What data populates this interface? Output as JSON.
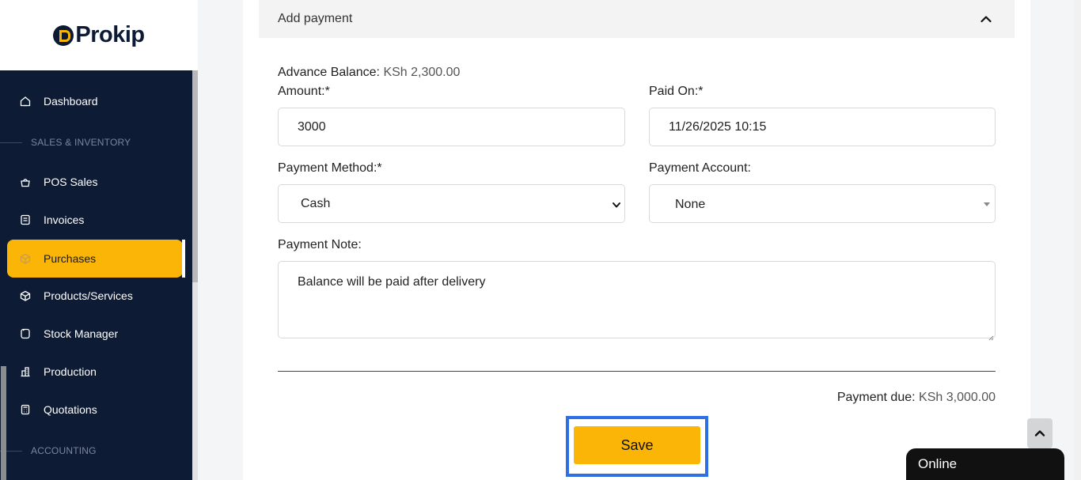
{
  "brand": {
    "logo_text": "Prokip"
  },
  "sidebar": {
    "items": [
      {
        "label": "Dashboard",
        "icon": "home-icon"
      },
      {
        "label": "POS Sales",
        "icon": "basket-icon"
      },
      {
        "label": "Invoices",
        "icon": "invoice-icon"
      },
      {
        "label": "Purchases",
        "icon": "box-icon",
        "active": true
      },
      {
        "label": "Products/Services",
        "icon": "cube-icon"
      },
      {
        "label": "Stock Manager",
        "icon": "stock-icon"
      },
      {
        "label": "Production",
        "icon": "factory-icon"
      },
      {
        "label": "Quotations",
        "icon": "calculator-icon"
      }
    ],
    "sections": [
      "SALES & INVENTORY",
      "ACCOUNTING"
    ]
  },
  "panel": {
    "title": "Add payment"
  },
  "form": {
    "advance_balance_label": "Advance Balance:",
    "advance_balance_value": "KSh 2,300.00",
    "amount_label": "Amount:*",
    "amount_value": "3000",
    "paid_on_label": "Paid On:*",
    "paid_on_value": "11/26/2025 10:15",
    "payment_method_label": "Payment Method:*",
    "payment_method_value": "Cash",
    "payment_account_label": "Payment Account:",
    "payment_account_value": "None",
    "payment_note_label": "Payment Note:",
    "payment_note_value": "Balance will be paid after delivery",
    "payment_due_label": "Payment due:",
    "payment_due_value": "KSh 3,000.00",
    "save_label": "Save"
  },
  "chat": {
    "status": "Online"
  },
  "colors": {
    "accent": "#fbb507",
    "sidebar_bg": "#0d1b35",
    "focus_ring": "#2f6fe6"
  }
}
